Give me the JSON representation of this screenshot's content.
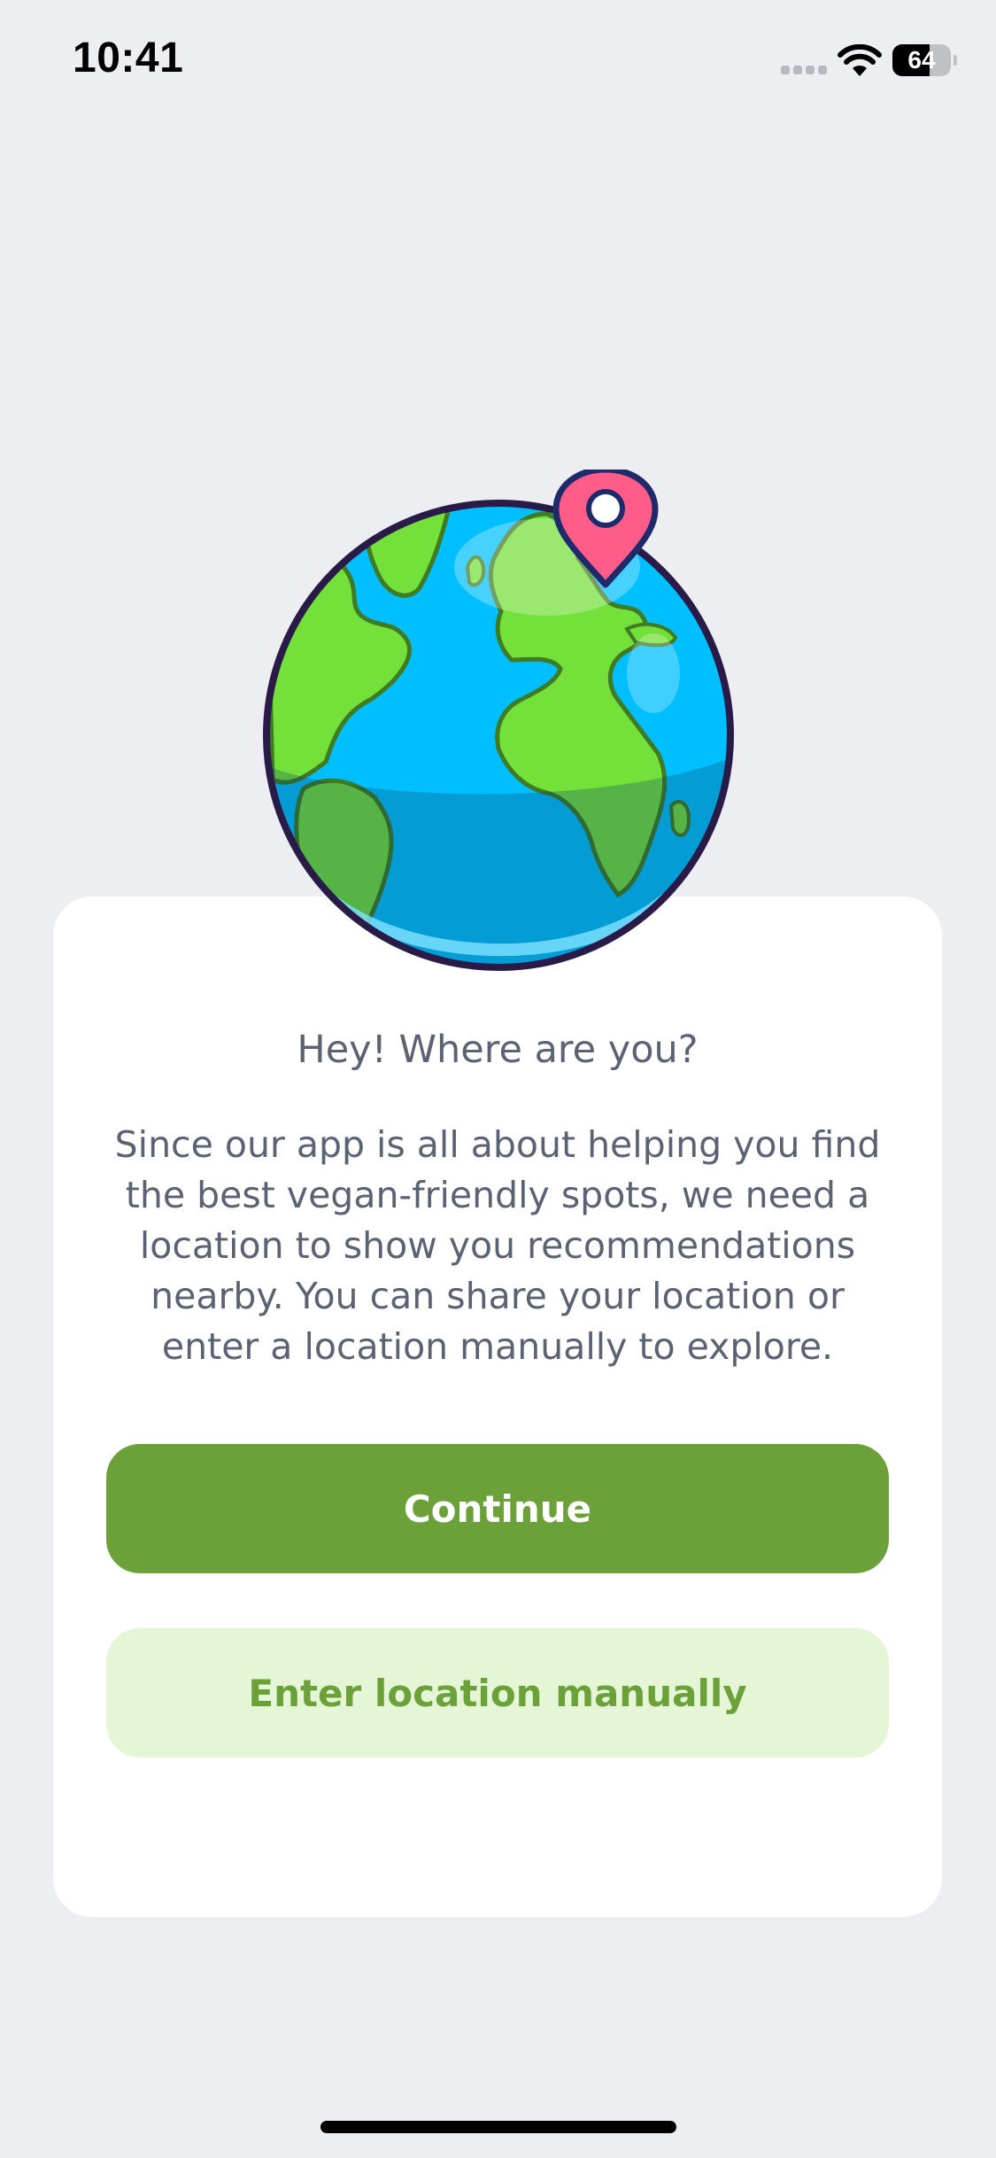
{
  "status_bar": {
    "time": "10:41",
    "battery_level": "64",
    "icons": [
      "signal-icon",
      "wifi-icon",
      "battery-icon"
    ]
  },
  "illustration": {
    "icon": "globe-with-location-pin-icon"
  },
  "card": {
    "title": "Hey! Where are you?",
    "description": "Since our app is all about helping you find the best vegan-friendly spots, we need a location to show you recommendations nearby. You can share your location or enter a location manually to explore."
  },
  "actions": {
    "continue_label": "Continue",
    "manual_label": "Enter location manually"
  },
  "colors": {
    "background": "#ECEEF2",
    "primary_green": "#6CA13A",
    "secondary_green_bg": "#E4F6D5",
    "text": "#5B6373"
  }
}
